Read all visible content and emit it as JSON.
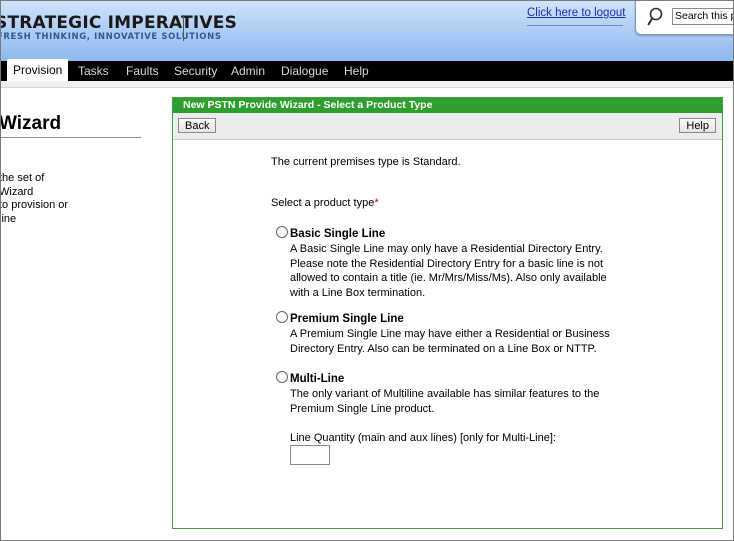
{
  "header": {
    "brand_title": "STRATEGIC IMPERATIVES",
    "brand_tagline": "FRESH THINKING, INNOVATIVE SOLUTIONS",
    "logout_link": "Click here to logout",
    "search_value": "Search this portal"
  },
  "nav": {
    "items": [
      "Provision",
      "Tasks",
      "Faults",
      "Security",
      "Admin",
      "Dialogue",
      "Help"
    ],
    "active": "Provision"
  },
  "left_pane": {
    "title": "Wizard",
    "description": [
      "the set of Wizard",
      "to provision or",
      "line"
    ]
  },
  "wizard": {
    "title": "New PSTN Provide Wizard - Select a Product Type",
    "back_button": "Back",
    "help_button": "Help",
    "premises_text": "The current premises type is Standard.",
    "select_prompt": "Select a product type",
    "required_marker": "*",
    "options": [
      {
        "label": "Basic Single Line",
        "description_lines": [
          "A Basic Single Line may only have a Residential Directory Entry.",
          "Please note the Residential Directory Entry for a basic line is not",
          "allowed to contain a title (ie. Mr/Mrs/Miss/Ms). Also only available",
          "with a Line Box termination."
        ]
      },
      {
        "label": "Premium Single Line",
        "description_lines": [
          "A Premium Single Line may have either a Residential or Business",
          "Directory Entry. Also can be terminated on a Line Box or NTTP."
        ]
      },
      {
        "label": "Multi-Line",
        "description_lines": [
          "The only variant of Multiline available has similar features to the",
          "Premium Single Line product."
        ]
      }
    ],
    "quantity_label": "Line Quantity (main and aux lines) [only for Multi-Line]:",
    "quantity_value": ""
  },
  "colors": {
    "header_blue": "#a9cbf4",
    "nav_black": "#000000",
    "wizard_green": "#2e9f2e",
    "required_red": "#c00000",
    "link_blue": "#1a2fb0"
  }
}
